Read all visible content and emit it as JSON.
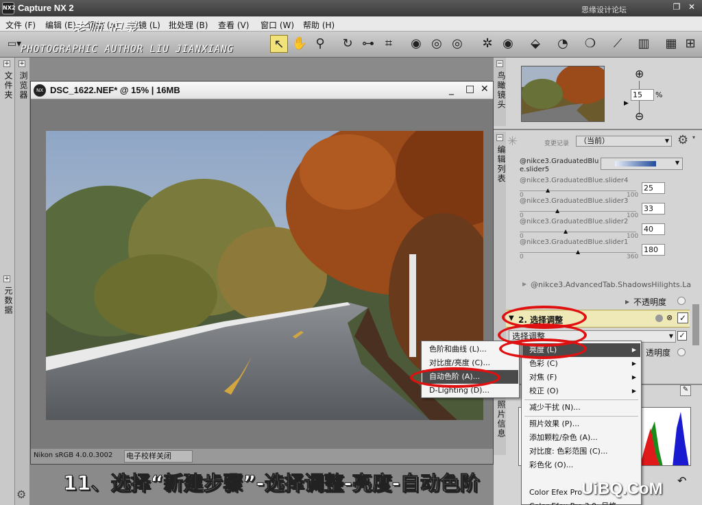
{
  "app": {
    "title": "Capture NX 2",
    "logo": "NX2",
    "watermark_top": "思缘设计论坛 www.MISSYUAN.COM"
  },
  "menus": [
    "文件 (F)",
    "编辑 (E)",
    "调整 (A)",
    "滤镜 (L)",
    "批处理 (B)",
    "查看 (V)",
    "窗口 (W)",
    "帮助 (H)"
  ],
  "watermark": {
    "cn": "老师 记录",
    "author": "PHOTOGRAPHIC AUTHOR LIU JIANXIANG"
  },
  "left_strip": {
    "folder": "文件夹",
    "browser": "浏览器",
    "metadata": "元数据"
  },
  "document": {
    "title": "DSC_1622.NEF* @ 15% | 16MB",
    "profile": "Nikon sRGB 4.0.0.3002",
    "proof": "电子校样关闭"
  },
  "birdseye": {
    "label": "鸟瞰镜头",
    "zoom": "15",
    "unit": "%"
  },
  "edit_list": {
    "label": "编辑列表",
    "history_label": "变更记录",
    "history_value": "（当前）",
    "gradient_label": "@nikce3.GraduatedBlue.slider5",
    "sliders": [
      {
        "label": "@nikce3.GraduatedBlue.slider4",
        "min": "0",
        "max": "100",
        "value": "25"
      },
      {
        "label": "@nikce3.GraduatedBlue.slider3",
        "min": "0",
        "max": "100",
        "value": "33"
      },
      {
        "label": "@nikce3.GraduatedBlue.slider2",
        "min": "0",
        "max": "100",
        "value": "40"
      },
      {
        "label": "@nikce3.GraduatedBlue.slider1",
        "min": "0",
        "max": "360",
        "value": "180"
      }
    ],
    "advanced_tab": "@nikce3.AdvancedTab.ShadowsHilights.La",
    "opacity": "不透明度",
    "step2": "2. 选择调整",
    "select_adjust": "选择调整",
    "opacity2": "透明度"
  },
  "photo_info": "照片信息",
  "main_menu": {
    "items": [
      "亮度 (L)",
      "色彩 (C)",
      "对焦 (F)",
      "校正 (O)",
      "减少干扰 (N)...",
      "照片效果 (P)...",
      "添加颗粒/杂色 (A)...",
      "对比度: 色彩范围 (C)...",
      "彩色化 (O)...",
      "Color Efex Pro",
      "Color Efex Pro 3.0: 风格"
    ]
  },
  "submenu": {
    "items": [
      "色阶和曲线 (L)...",
      "对比度/亮度 (C)...",
      "自动色阶 (A)...",
      "D-Lighting (D)..."
    ]
  },
  "caption": "11、选择“新建步骤”-选择调整-亮度-自动色阶",
  "watermark_bottom": "UiBQ.CoM"
}
